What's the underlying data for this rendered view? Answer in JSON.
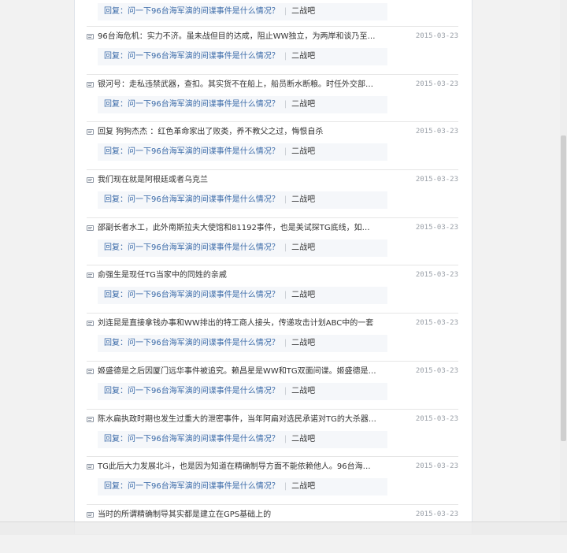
{
  "replies": {
    "quote_prefix": "回复：",
    "items": [
      {
        "text": "",
        "date": "",
        "quote": "问一下96台海军演的间谍事件是什么情况？",
        "forum": "二战吧"
      },
      {
        "text": "96台海危机：实力不济。虽未战但目的达成，阻止WW独立，为两岸和谈乃至后…",
        "date": "2015-03-23",
        "quote": "问一下96台海军演的间谍事件是什么情况？",
        "forum": "二战吧"
      },
      {
        "text": "银河号：走私违禁武器，查扣。其实货不在船上，船员断水断粮。时任外交部…",
        "date": "2015-03-23",
        "quote": "问一下96台海军演的间谍事件是什么情况？",
        "forum": "二战吧"
      },
      {
        "text": "回复 狗狗杰杰 ：红色革命家出了败类，养不教父之过，悔恨自杀",
        "date": "2015-03-23",
        "quote": "问一下96台海军演的间谍事件是什么情况？",
        "forum": "二战吧"
      },
      {
        "text": "我们现在就是阿根廷或者乌克兰",
        "date": "2015-03-23",
        "quote": "问一下96台海军演的间谍事件是什么情况？",
        "forum": "二战吧"
      },
      {
        "text": "邵副长者水工，此外南斯拉夫大使馆和81192事件，也是美试探TG底线，如长者…",
        "date": "2015-03-23",
        "quote": "问一下96台海军演的间谍事件是什么情况？",
        "forum": "二战吧"
      },
      {
        "text": "俞强生是现任TG当家中的同姓的亲戚",
        "date": "2015-03-23",
        "quote": "问一下96台海军演的间谍事件是什么情况？",
        "forum": "二战吧"
      },
      {
        "text": "刘连昆是直接拿钱办事和WW排出的特工商人接头，传递攻击计划ABC中的一套",
        "date": "2015-03-23",
        "quote": "问一下96台海军演的间谍事件是什么情况？",
        "forum": "二战吧"
      },
      {
        "text": "姬盛德是之后因厦门远华事件被追究。赖昌星是WW和TG双面间谍。姬盛德是其…",
        "date": "2015-03-23",
        "quote": "问一下96台海军演的间谍事件是什么情况？",
        "forum": "二战吧"
      },
      {
        "text": "陈水扁执政时期也发生过重大的泄密事件，当年阿扁对选民承诺对TG的大杀器…",
        "date": "2015-03-23",
        "quote": "问一下96台海军演的间谍事件是什么情况？",
        "forum": "二战吧"
      },
      {
        "text": "TG此后大力发展北斗，也是因为知道在精确制导方面不能依赖他人。96台海事…",
        "date": "2015-03-23",
        "quote": "问一下96台海军演的间谍事件是什么情况？",
        "forum": "二战吧"
      },
      {
        "text": "当时的所谓精确制导其实都是建立在GPS基础上的",
        "date": "2015-03-23",
        "quote": "",
        "forum": ""
      }
    ]
  }
}
